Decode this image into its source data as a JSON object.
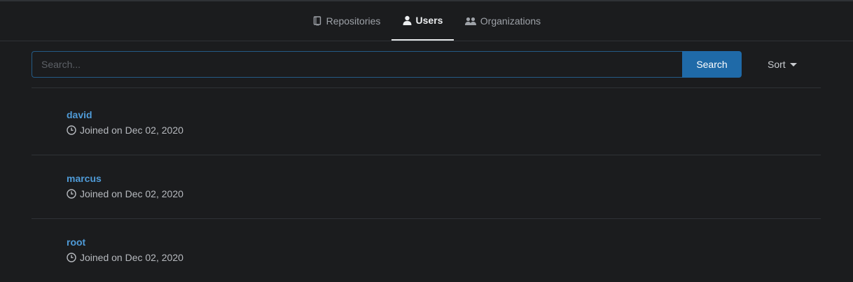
{
  "tabs": [
    {
      "label": "Repositories",
      "icon": "book-icon",
      "active": false
    },
    {
      "label": "Users",
      "icon": "user-icon",
      "active": true
    },
    {
      "label": "Organizations",
      "icon": "organization-icon",
      "active": false
    }
  ],
  "search": {
    "placeholder": "Search...",
    "value": "",
    "button_label": "Search"
  },
  "sort": {
    "label": "Sort"
  },
  "users": [
    {
      "name": "david",
      "joined": "Joined on Dec 02, 2020"
    },
    {
      "name": "marcus",
      "joined": "Joined on Dec 02, 2020"
    },
    {
      "name": "root",
      "joined": "Joined on Dec 02, 2020"
    }
  ],
  "colors": {
    "background": "#1b1c1e",
    "accent": "#1f6aa8",
    "link": "#4f9bd8",
    "divider": "#2f3236"
  }
}
